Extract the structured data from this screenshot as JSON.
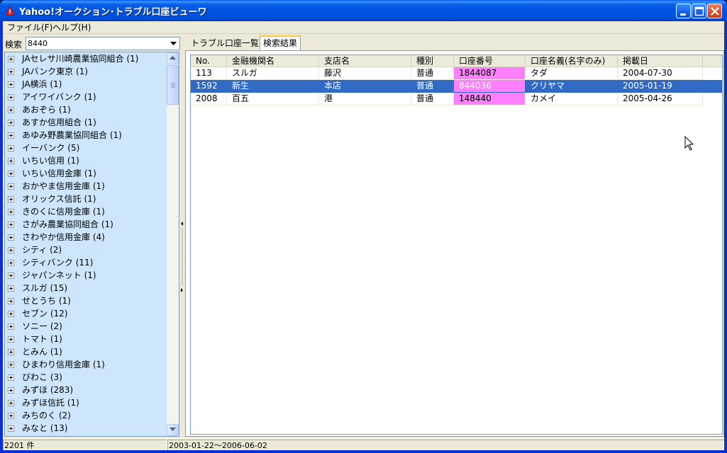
{
  "window": {
    "title": "Yahoo!オークション･トラブル口座ビューワ",
    "controls": [
      "minimize",
      "maximize",
      "close"
    ]
  },
  "menu": [
    {
      "label": "ファイル(F)"
    },
    {
      "label": "ヘルプ(H)"
    }
  ],
  "search": {
    "label": "検索",
    "value": "8440"
  },
  "tree": {
    "items": [
      {
        "label": "JAセレサ川崎農業協同組合 (1)"
      },
      {
        "label": "JAバンク東京 (1)"
      },
      {
        "label": "JA横浜 (1)"
      },
      {
        "label": "アイワイバンク (1)"
      },
      {
        "label": "あおぞら (1)"
      },
      {
        "label": "あすか信用組合 (1)"
      },
      {
        "label": "あゆみ野農業協同組合 (1)"
      },
      {
        "label": "イーバンク (5)"
      },
      {
        "label": "いちい信用 (1)"
      },
      {
        "label": "いちい信用金庫 (1)"
      },
      {
        "label": "おかやま信用金庫 (1)"
      },
      {
        "label": "オリックス信託 (1)"
      },
      {
        "label": "きのくに信用金庫 (1)"
      },
      {
        "label": "さがみ農業協同組合 (1)"
      },
      {
        "label": "さわやか信用金庫 (4)"
      },
      {
        "label": "シティ (2)"
      },
      {
        "label": "シティバンク (11)"
      },
      {
        "label": "ジャパンネット (1)"
      },
      {
        "label": "スルガ (15)"
      },
      {
        "label": "せとうち (1)"
      },
      {
        "label": "セブン (12)"
      },
      {
        "label": "ソニー (2)"
      },
      {
        "label": "トマト (1)"
      },
      {
        "label": "とみん (1)"
      },
      {
        "label": "ひまわり信用金庫 (1)"
      },
      {
        "label": "びわこ (3)"
      },
      {
        "label": "みずほ (283)"
      },
      {
        "label": "みずほ信託 (1)"
      },
      {
        "label": "みちのく (2)"
      },
      {
        "label": "みなと (13)"
      }
    ]
  },
  "tabs": [
    {
      "label": "トラブル口座一覧",
      "active": false
    },
    {
      "label": "検索結果",
      "active": true
    }
  ],
  "grid": {
    "columns": [
      "No.",
      "金融機関名",
      "支店名",
      "種別",
      "口座番号",
      "口座名義(名字のみ)",
      "掲載日"
    ],
    "rows": [
      {
        "no": "113",
        "bank": "スルガ",
        "branch": "藤沢",
        "type": "普通",
        "account": "1844087",
        "holder": "タダ",
        "date": "2004-07-30",
        "selected": false
      },
      {
        "no": "1592",
        "bank": "新生",
        "branch": "本店",
        "type": "普通",
        "account": "844036",
        "holder": "クリヤマ",
        "date": "2005-01-19",
        "selected": true
      },
      {
        "no": "2008",
        "bank": "百五",
        "branch": "港",
        "type": "普通",
        "account": "148440",
        "holder": "カメイ",
        "date": "2005-04-26",
        "selected": false
      }
    ],
    "highlight_color": "#ff80ff",
    "selection_color": "#316ac5"
  },
  "status": {
    "count": "2201 件",
    "range": "2003-01-22～2006-06-02"
  }
}
